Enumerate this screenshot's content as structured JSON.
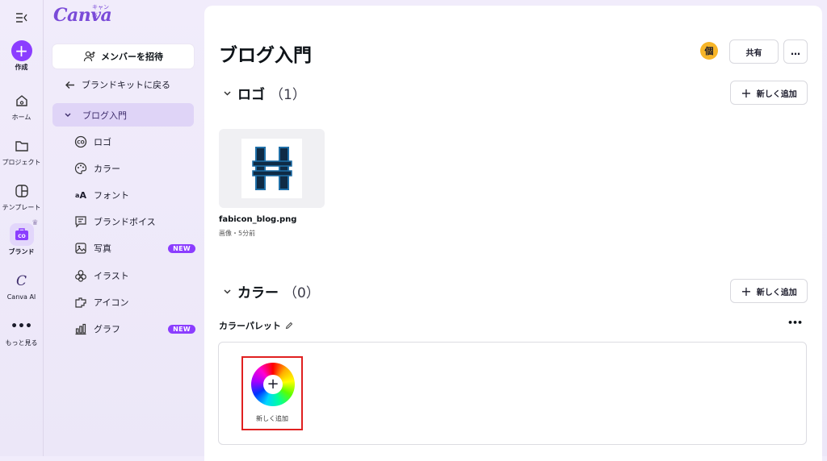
{
  "rail": {
    "items": [
      {
        "label": "作成"
      },
      {
        "label": "ホーム"
      },
      {
        "label": "プロジェクト"
      },
      {
        "label": "テンプレート"
      },
      {
        "label": "ブランド"
      },
      {
        "label": "Canva AI"
      },
      {
        "label": "もっと見る"
      }
    ]
  },
  "panel": {
    "logo": "Canva",
    "logo_kana": "キャンバ",
    "invite_label": "メンバーを招待",
    "back_label": "ブランドキットに戻る",
    "kit_label": "ブログ入門",
    "items": [
      {
        "label": "ロゴ",
        "icon": "logo-icon"
      },
      {
        "label": "カラー",
        "icon": "palette-icon"
      },
      {
        "label": "フォント",
        "icon": "font-icon"
      },
      {
        "label": "ブランドボイス",
        "icon": "brand-voice-icon"
      },
      {
        "label": "写真",
        "icon": "photo-icon",
        "badge": "NEW"
      },
      {
        "label": "イラスト",
        "icon": "illustration-icon"
      },
      {
        "label": "アイコン",
        "icon": "icons-icon"
      },
      {
        "label": "グラフ",
        "icon": "chart-icon",
        "badge": "NEW"
      }
    ]
  },
  "header": {
    "title": "ブログ入門",
    "avatar": "個",
    "share_label": "共有",
    "more": "…"
  },
  "logos": {
    "title": "ロゴ",
    "count": "（1）",
    "add_label": "新しく追加",
    "file_name": "fabicon_blog.png",
    "file_meta": "画像・5分前"
  },
  "colors": {
    "title": "カラー",
    "count": "（0）",
    "add_label": "新しく追加",
    "palette_label": "カラーパレット",
    "add_color_label": "新しく追加"
  },
  "accent": "#8b3dff"
}
